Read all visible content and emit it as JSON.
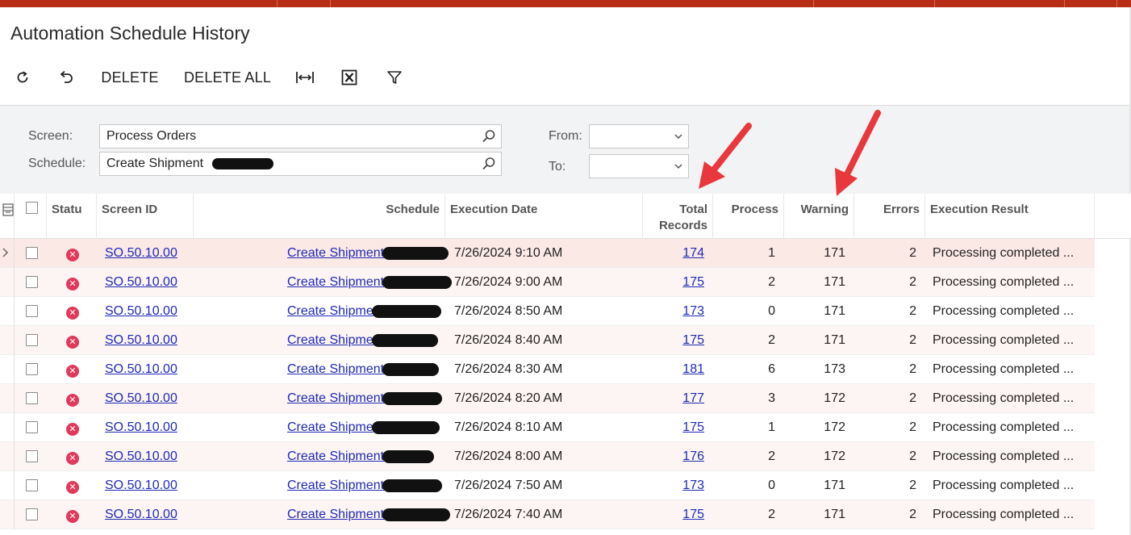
{
  "page": {
    "title": "Automation Schedule History"
  },
  "toolbar": {
    "refresh_icon": "refresh-icon",
    "undo_icon": "undo-icon",
    "delete_label": "DELETE",
    "delete_all_label": "DELETE ALL",
    "fit_icon": "fit-columns-icon",
    "excel_icon": "excel-export-icon",
    "filter_icon": "filter-icon"
  },
  "filters": {
    "screen_label": "Screen:",
    "screen_value": "Process Orders",
    "schedule_label": "Schedule:",
    "schedule_value": "Create Shipment",
    "from_label": "From:",
    "from_value": "",
    "to_label": "To:",
    "to_value": ""
  },
  "columns": {
    "status": "Statu",
    "screen_id": "Screen ID",
    "schedule": "Schedule",
    "execution_date": "Execution Date",
    "total_records_1": "Total",
    "total_records_2": "Records",
    "process": "Process",
    "warning": "Warning",
    "errors": "Errors",
    "execution_result": "Execution Result"
  },
  "rows": [
    {
      "screen_id": "SO.50.10.00",
      "schedule": "Create Shipment",
      "date": "7/26/2024 9:10 AM",
      "total": "174",
      "process": "1",
      "warning": "171",
      "errors": "2",
      "result": "Processing completed ..."
    },
    {
      "screen_id": "SO.50.10.00",
      "schedule": "Create Shipment",
      "date": "7/26/2024 9:00 AM",
      "total": "175",
      "process": "2",
      "warning": "171",
      "errors": "2",
      "result": "Processing completed ..."
    },
    {
      "screen_id": "SO.50.10.00",
      "schedule": "Create Shipme",
      "date": "7/26/2024 8:50 AM",
      "total": "173",
      "process": "0",
      "warning": "171",
      "errors": "2",
      "result": "Processing completed ..."
    },
    {
      "screen_id": "SO.50.10.00",
      "schedule": "Create Shipme",
      "date": "7/26/2024 8:40 AM",
      "total": "175",
      "process": "2",
      "warning": "171",
      "errors": "2",
      "result": "Processing completed ..."
    },
    {
      "screen_id": "SO.50.10.00",
      "schedule": "Create Shipment",
      "date": "7/26/2024 8:30 AM",
      "total": "181",
      "process": "6",
      "warning": "173",
      "errors": "2",
      "result": "Processing completed ..."
    },
    {
      "screen_id": "SO.50.10.00",
      "schedule": "Create Shipment",
      "date": "7/26/2024 8:20 AM",
      "total": "177",
      "process": "3",
      "warning": "172",
      "errors": "2",
      "result": "Processing completed ..."
    },
    {
      "screen_id": "SO.50.10.00",
      "schedule": "Create Shipme",
      "date": "7/26/2024 8:10 AM",
      "total": "175",
      "process": "1",
      "warning": "172",
      "errors": "2",
      "result": "Processing completed ..."
    },
    {
      "screen_id": "SO.50.10.00",
      "schedule": "Create Shipment",
      "date": "7/26/2024 8:00 AM",
      "total": "176",
      "process": "2",
      "warning": "172",
      "errors": "2",
      "result": "Processing completed ..."
    },
    {
      "screen_id": "SO.50.10.00",
      "schedule": "Create Shipment",
      "date": "7/26/2024 7:50 AM",
      "total": "173",
      "process": "0",
      "warning": "171",
      "errors": "2",
      "result": "Processing completed ..."
    },
    {
      "screen_id": "SO.50.10.00",
      "schedule": "Create Shipment",
      "date": "7/26/2024 7:40 AM",
      "total": "175",
      "process": "2",
      "warning": "171",
      "errors": "2",
      "result": "Processing completed ..."
    }
  ],
  "colors": {
    "topbar": "#b82d16",
    "link": "#1f2ab5",
    "error_icon": "#e0395a",
    "annotation_arrow": "#e8383d"
  }
}
